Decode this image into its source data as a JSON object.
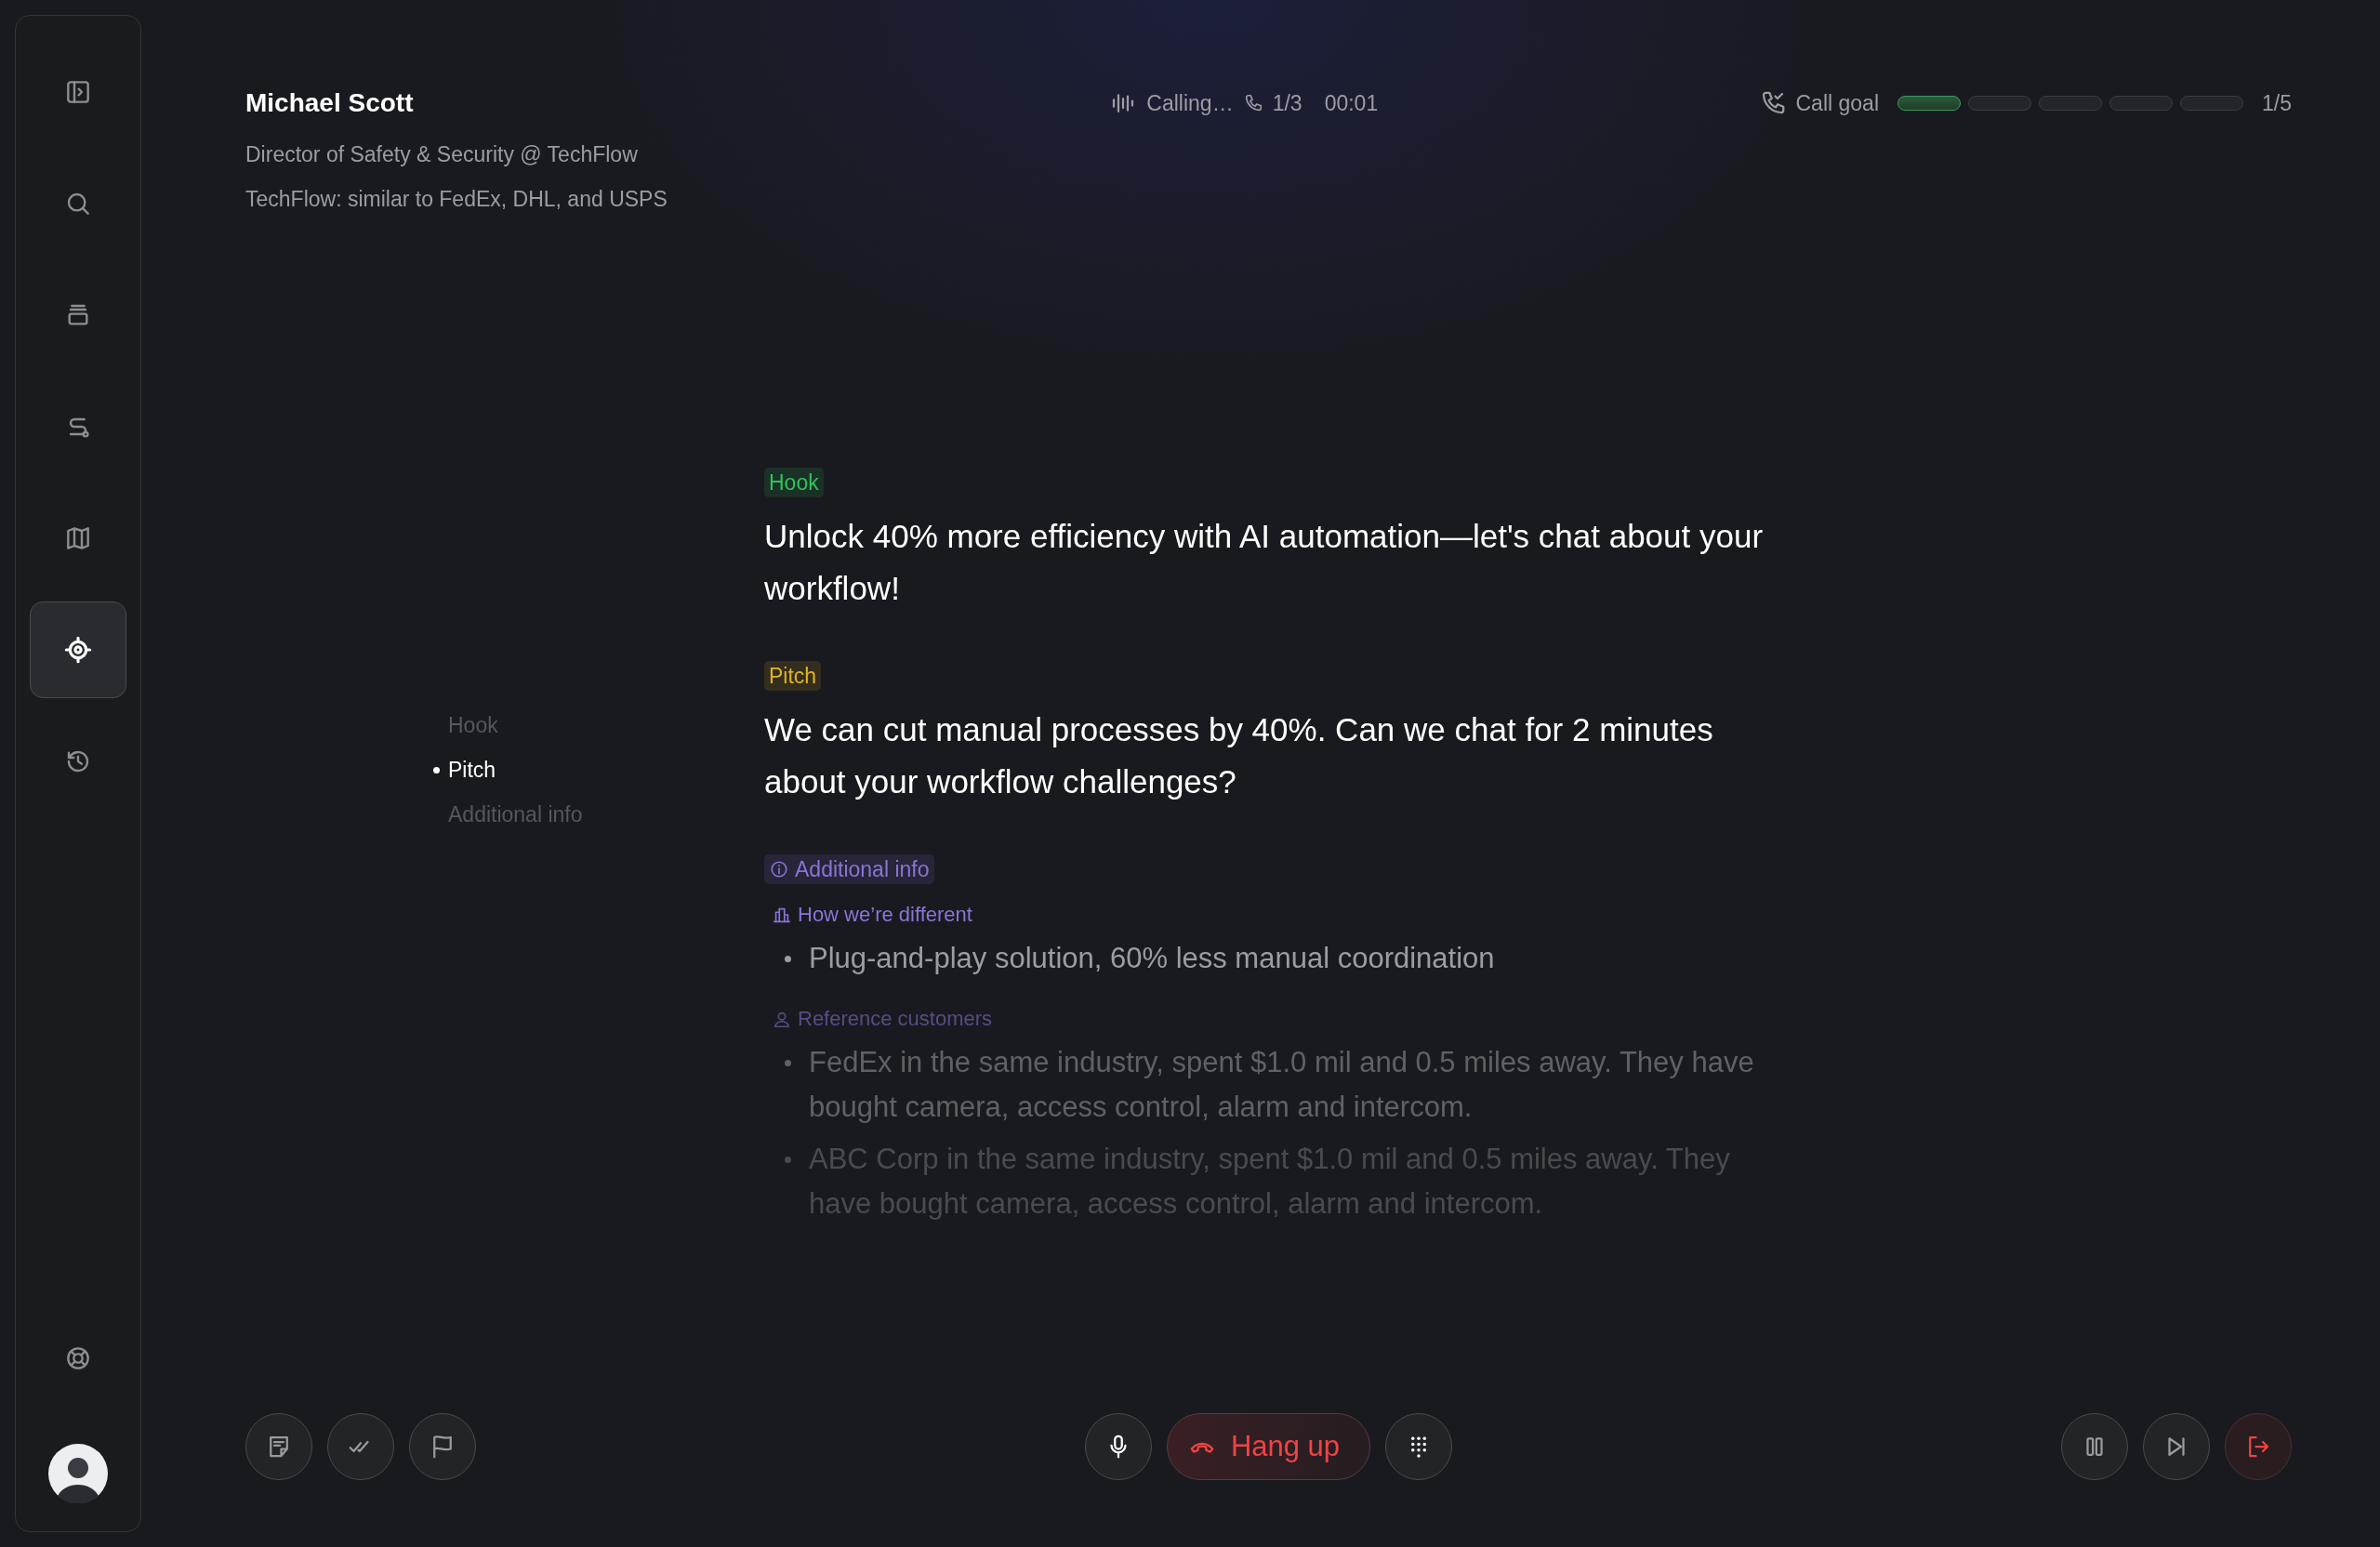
{
  "sidebar": {
    "items": [
      {
        "kind": "panel",
        "selected": false
      },
      {
        "kind": "search",
        "selected": false
      },
      {
        "kind": "stack",
        "selected": false
      },
      {
        "kind": "route",
        "selected": false
      },
      {
        "kind": "map",
        "selected": false
      },
      {
        "kind": "target",
        "selected": true
      },
      {
        "kind": "history",
        "selected": false
      }
    ],
    "footer": [
      {
        "kind": "help"
      }
    ]
  },
  "contact": {
    "name": "Michael Scott",
    "title": "Director of Safety & Security @ TechFlow",
    "company_note": "TechFlow: similar to FedEx, DHL, and USPS"
  },
  "call_status": {
    "state": "Calling…",
    "attempts": "1/3",
    "timer": "00:01"
  },
  "call_goal": {
    "label": "Call goal",
    "count": "1/5",
    "steps": [
      {
        "done": true
      },
      {
        "done": false
      },
      {
        "done": false
      },
      {
        "done": false
      },
      {
        "done": false
      }
    ]
  },
  "outline": [
    {
      "label": "Hook",
      "selected": false
    },
    {
      "label": "Pitch",
      "selected": true
    },
    {
      "label": "Additional info",
      "selected": false
    }
  ],
  "sections": [
    {
      "kind": "script",
      "tag": "Hook",
      "color": "#2fc35c",
      "text": "Unlock 40% more efficiency with AI automation—let's chat about your workflow!"
    },
    {
      "kind": "script",
      "tag": "Pitch",
      "color": "#e2b320",
      "text": "We can cut manual processes by 40%. Can we chat for 2 minutes about your workflow challenges?"
    },
    {
      "kind": "info",
      "tag": "Additional info",
      "color": "#8a74d6",
      "groups": [
        {
          "kind": "building",
          "title": "How we’re different",
          "items": [
            "Plug-and-play solution, 60% less manual coordination"
          ]
        },
        {
          "kind": "person",
          "title": "Reference customers",
          "items": [
            "FedEx in the same industry, spent $1.0 mil and 0.5 miles away. They have bought camera, access control, alarm and intercom.",
            "ABC Corp in the same industry, spent $1.0 mil and 0.5 miles away. They have bought camera, access control, alarm and intercom."
          ]
        }
      ]
    }
  ],
  "controls": {
    "left": [
      {
        "kind": "note"
      },
      {
        "kind": "checks"
      },
      {
        "kind": "flag"
      }
    ],
    "hangup": {
      "label": "Hang up"
    },
    "right": [
      {
        "kind": "pause"
      },
      {
        "kind": "skip"
      },
      {
        "kind": "exit"
      }
    ]
  }
}
